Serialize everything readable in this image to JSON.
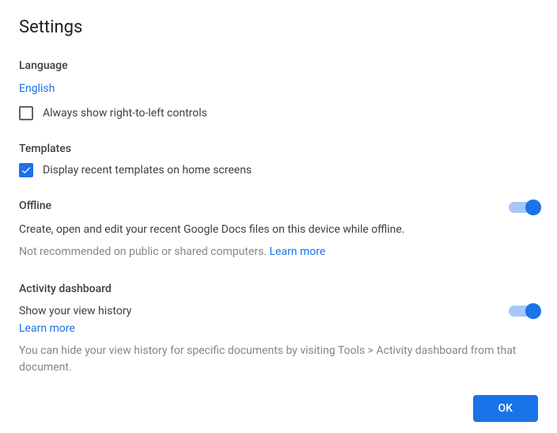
{
  "title": "Settings",
  "language": {
    "heading": "Language",
    "value": "English",
    "rtl_label": "Always show right-to-left controls",
    "rtl_checked": false
  },
  "templates": {
    "heading": "Templates",
    "recent_label": "Display recent templates on home screens",
    "recent_checked": true
  },
  "offline": {
    "heading": "Offline",
    "desc": "Create, open and edit your recent Google Docs files on this device while offline.",
    "note": "Not recommended on public or shared computers. ",
    "learn_more": "Learn more",
    "enabled": true
  },
  "activity": {
    "heading": "Activity dashboard",
    "show_label": "Show your view history",
    "learn_more": "Learn more",
    "desc": "You can hide your view history for specific documents by visiting Tools > Activity dashboard from that document.",
    "enabled": true
  },
  "ok_label": "OK"
}
